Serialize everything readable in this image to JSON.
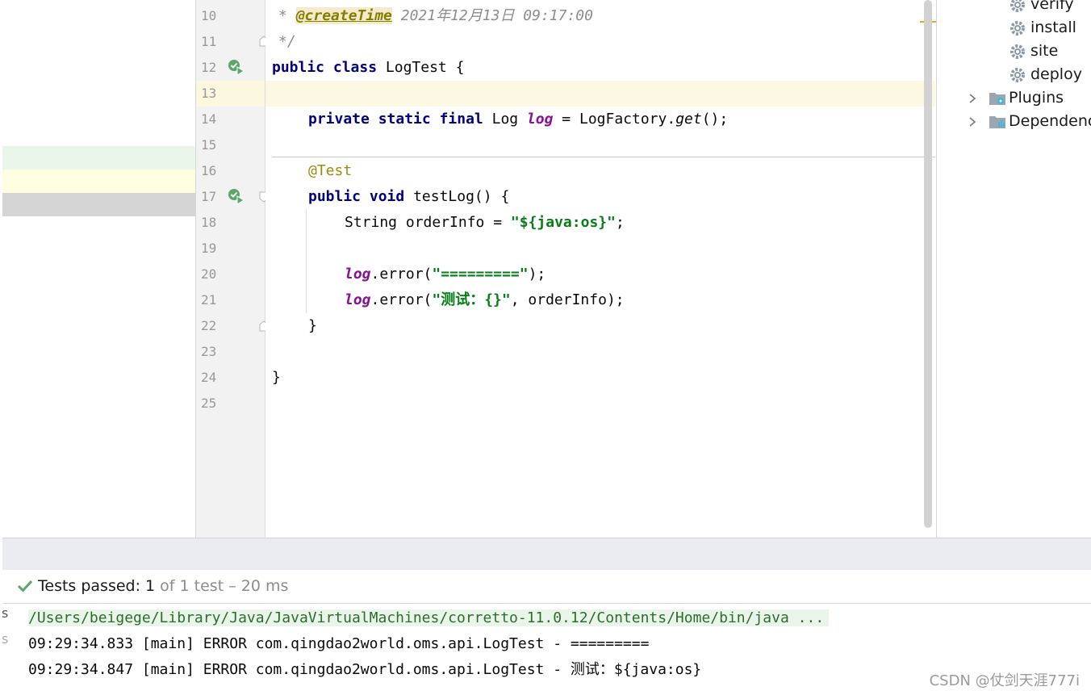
{
  "editor": {
    "line_numbers": [
      "10",
      "11",
      "12",
      "13",
      "14",
      "15",
      "16",
      "17",
      "18",
      "19",
      "20",
      "21",
      "22",
      "23",
      "24",
      "25"
    ],
    "lines": {
      "l10": {
        "star": "* ",
        "tag": "@createTime",
        "rest": " 2021年12月13日 09:17:00"
      },
      "l11": {
        "text": "*/"
      },
      "l12": {
        "kw1": "public",
        "kw2": "class",
        "name": " LogTest {"
      },
      "l14": {
        "kw1": "private",
        "kw2": "static",
        "kw3": "final",
        "type": " Log ",
        "field": "log",
        "mid": " = LogFactory.",
        "method": "get",
        "end": "();"
      },
      "l16": {
        "anno": "@Test"
      },
      "l17": {
        "kw1": "public",
        "kw2": "void",
        "rest": " testLog() {"
      },
      "l18": {
        "pre": "String orderInfo = ",
        "str": "\"${java:os}\"",
        "end": ";"
      },
      "l20": {
        "field": "log",
        "mid": ".error(",
        "str": "\"=========\"",
        "end": ");"
      },
      "l21": {
        "field": "log",
        "mid": ".error(",
        "str": "\"测试：{}\"",
        "end": ", orderInfo);"
      },
      "l22": {
        "text": "}"
      },
      "l24": {
        "text": "}"
      }
    }
  },
  "maven": {
    "items": [
      {
        "label": "verify",
        "icon": "gear-icon"
      },
      {
        "label": "install",
        "icon": "gear-icon"
      },
      {
        "label": "site",
        "icon": "gear-icon"
      },
      {
        "label": "deploy",
        "icon": "gear-icon"
      }
    ],
    "folders": [
      {
        "label": "Plugins",
        "icon": "plugins-folder-icon"
      },
      {
        "label": "Dependenc",
        "icon": "dependencies-folder-icon"
      }
    ]
  },
  "run": {
    "status_label": "Tests passed: ",
    "status_count": "1",
    "status_rest": " of 1 test – 20 ms",
    "console": [
      "/Users/beigege/Library/Java/JavaVirtualMachines/corretto-11.0.12/Contents/Home/bin/java ...",
      "09:29:34.833 [main] ERROR com.qingdao2world.oms.api.LogTest - =========",
      "09:29:34.847 [main] ERROR com.qingdao2world.oms.api.LogTest - 测试：${java:os}"
    ],
    "side_glyphs": [
      "s",
      "s"
    ]
  },
  "watermark": "CSDN @仗剑天涯777i",
  "colors": {
    "accent_green": "#59a869",
    "keyword": "#0033b3",
    "string": "#067d17",
    "field": "#871094"
  }
}
